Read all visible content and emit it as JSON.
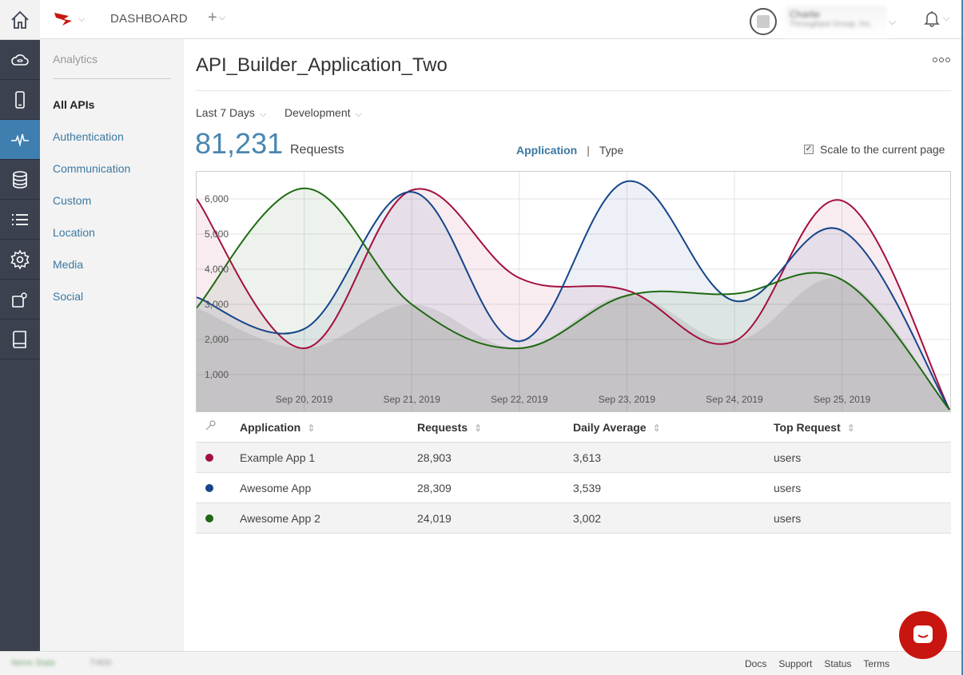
{
  "topbar": {
    "dashboard_label": "DASHBOARD",
    "user_name": "Charlie",
    "user_org": "Throughput Group, Inc."
  },
  "sidebar": {
    "title": "Analytics",
    "items": [
      {
        "label": "All APIs",
        "active": true
      },
      {
        "label": "Authentication"
      },
      {
        "label": "Communication"
      },
      {
        "label": "Custom"
      },
      {
        "label": "Location"
      },
      {
        "label": "Media"
      },
      {
        "label": "Social"
      }
    ]
  },
  "main": {
    "title": "API_Builder_Application_Two",
    "filters": {
      "range": "Last 7 Days",
      "env": "Development"
    },
    "total_requests": "81,231",
    "requests_label": "Requests",
    "toggle": {
      "active": "Application",
      "inactive": "Type"
    },
    "scale_label": "Scale to the current page"
  },
  "chart_data": {
    "type": "area",
    "x": [
      "Sep 19, 2019",
      "Sep 20, 2019",
      "Sep 21, 2019",
      "Sep 22, 2019",
      "Sep 23, 2019",
      "Sep 24, 2019",
      "Sep 25, 2019",
      "Sep 26, 2019"
    ],
    "x_tick_labels": [
      "Sep 20, 2019",
      "Sep 21, 2019",
      "Sep 22, 2019",
      "Sep 23, 2019",
      "Sep 24, 2019",
      "Sep 25, 2019"
    ],
    "y_ticks": [
      "1,000",
      "2,000",
      "3,000",
      "4,000",
      "5,000",
      "6,000"
    ],
    "ylim": [
      0,
      6250
    ],
    "grid": true,
    "series": [
      {
        "name": "Example App 1",
        "color": "#a3103f",
        "values": [
          6000,
          1750,
          6250,
          3750,
          3400,
          1950,
          5950,
          0
        ]
      },
      {
        "name": "Awesome App",
        "color": "#15458a",
        "values": [
          3200,
          2300,
          6200,
          1950,
          6500,
          3100,
          5100,
          0
        ]
      },
      {
        "name": "Awesome App 2",
        "color": "#1e6a12",
        "values": [
          2900,
          6300,
          3000,
          1750,
          3250,
          3300,
          3700,
          0
        ]
      }
    ]
  },
  "table": {
    "headers": [
      "Application",
      "Requests",
      "Daily Average",
      "Top Request"
    ],
    "rows": [
      {
        "name": "Example App 1",
        "requests": "28,903",
        "avg": "3,613",
        "top": "users",
        "color": "#a3103f"
      },
      {
        "name": "Awesome App",
        "requests": "28,309",
        "avg": "3,539",
        "top": "users",
        "color": "#15458a"
      },
      {
        "name": "Awesome App 2",
        "requests": "24,019",
        "avg": "3,002",
        "top": "users",
        "color": "#1e6a12"
      }
    ]
  },
  "footer": {
    "status_text": "Items Stats",
    "count_text": "7/400",
    "links": [
      "Docs",
      "Support",
      "Status",
      "Terms"
    ]
  }
}
